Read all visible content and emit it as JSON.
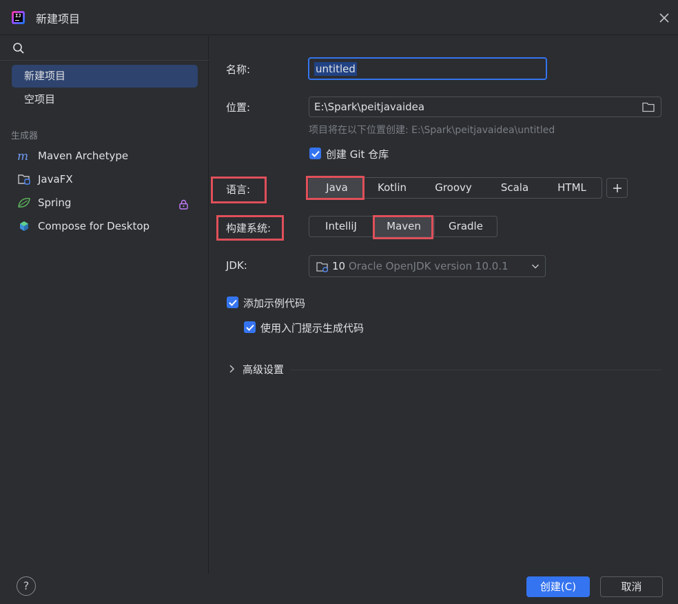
{
  "window": {
    "title": "新建项目"
  },
  "sidebar": {
    "items": [
      {
        "label": "新建项目",
        "selected": true
      },
      {
        "label": "空项目",
        "selected": false
      }
    ],
    "generators_label": "生成器",
    "generators": [
      {
        "label": "Maven Archetype",
        "icon": "maven-icon"
      },
      {
        "label": "JavaFX",
        "icon": "javafx-folder-icon"
      },
      {
        "label": "Spring",
        "icon": "spring-leaf-icon"
      },
      {
        "label": "Compose for Desktop",
        "icon": "compose-icon"
      }
    ]
  },
  "form": {
    "name_label": "名称:",
    "name_value": "untitled",
    "location_label": "位置:",
    "location_value": "E:\\Spark\\peitjavaidea",
    "location_hint": "项目将在以下位置创建: E:\\Spark\\peitjavaidea\\untitled",
    "git_label": "创建 Git 仓库",
    "git_checked": true,
    "language_label": "语言:",
    "languages": [
      "Java",
      "Kotlin",
      "Groovy",
      "Scala",
      "HTML"
    ],
    "language_selected": "Java",
    "build_label": "构建系统:",
    "build_systems": [
      "IntelliJ",
      "Maven",
      "Gradle"
    ],
    "build_selected": "Maven",
    "jdk_label": "JDK:",
    "jdk_version": "10",
    "jdk_desc": "Oracle OpenJDK version 10.0.1",
    "sample_label": "添加示例代码",
    "sample_checked": true,
    "onboarding_label": "使用入门提示生成代码",
    "onboarding_checked": true,
    "advanced_label": "高级设置"
  },
  "footer": {
    "help_label": "?",
    "create_label": "创建(C)",
    "cancel_label": "取消"
  },
  "colors": {
    "accent": "#3574f0",
    "highlight": "#e0505a",
    "background": "#2b2d30"
  }
}
